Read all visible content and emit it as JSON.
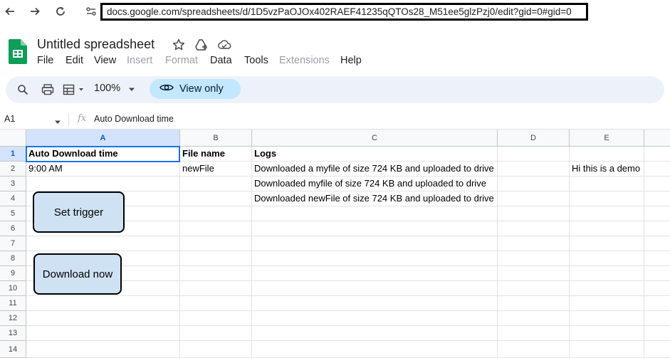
{
  "browser": {
    "url": "docs.google.com/spreadsheets/d/1D5vzPaOJOx402RAEF41235qQTOs28_M51ee5glzPzj0/edit?gid=0#gid=0"
  },
  "doc": {
    "title": "Untitled spreadsheet"
  },
  "menu": [
    "File",
    "Edit",
    "View",
    "Insert",
    "Format",
    "Data",
    "Tools",
    "Extensions",
    "Help"
  ],
  "toolbar": {
    "zoom": "100%",
    "view_only": "View only"
  },
  "formula_bar": {
    "cell_ref": "A1",
    "fx": "fx",
    "content": "Auto Download time"
  },
  "columns": [
    "A",
    "B",
    "C",
    "D",
    "E"
  ],
  "rows": [
    "1",
    "2",
    "3",
    "4",
    "5",
    "6",
    "7",
    "8",
    "9",
    "10",
    "11",
    "12",
    "13",
    "14"
  ],
  "cells": {
    "A1": "Auto Download time",
    "B1": "File name",
    "C1": "Logs",
    "A2": "9:00 AM",
    "B2": "newFile",
    "C2": "Downloaded a myfile of size 724 KB and uploaded to drive",
    "E2": "Hi this is a demo",
    "C3": "Downloaded myfile of size 724 KB and uploaded to drive",
    "C4": "Downloaded newFile of size 724 KB and uploaded to drive"
  },
  "drawings": {
    "set_trigger": "Set trigger",
    "download_now": "Download now"
  },
  "colors": {
    "selection": "#1a73e8",
    "header_selected": "#d3e3fd",
    "button_fill": "#cfe2f3",
    "view_only_chip": "#c2e7ff",
    "sheets_green": "#0f9d58"
  }
}
